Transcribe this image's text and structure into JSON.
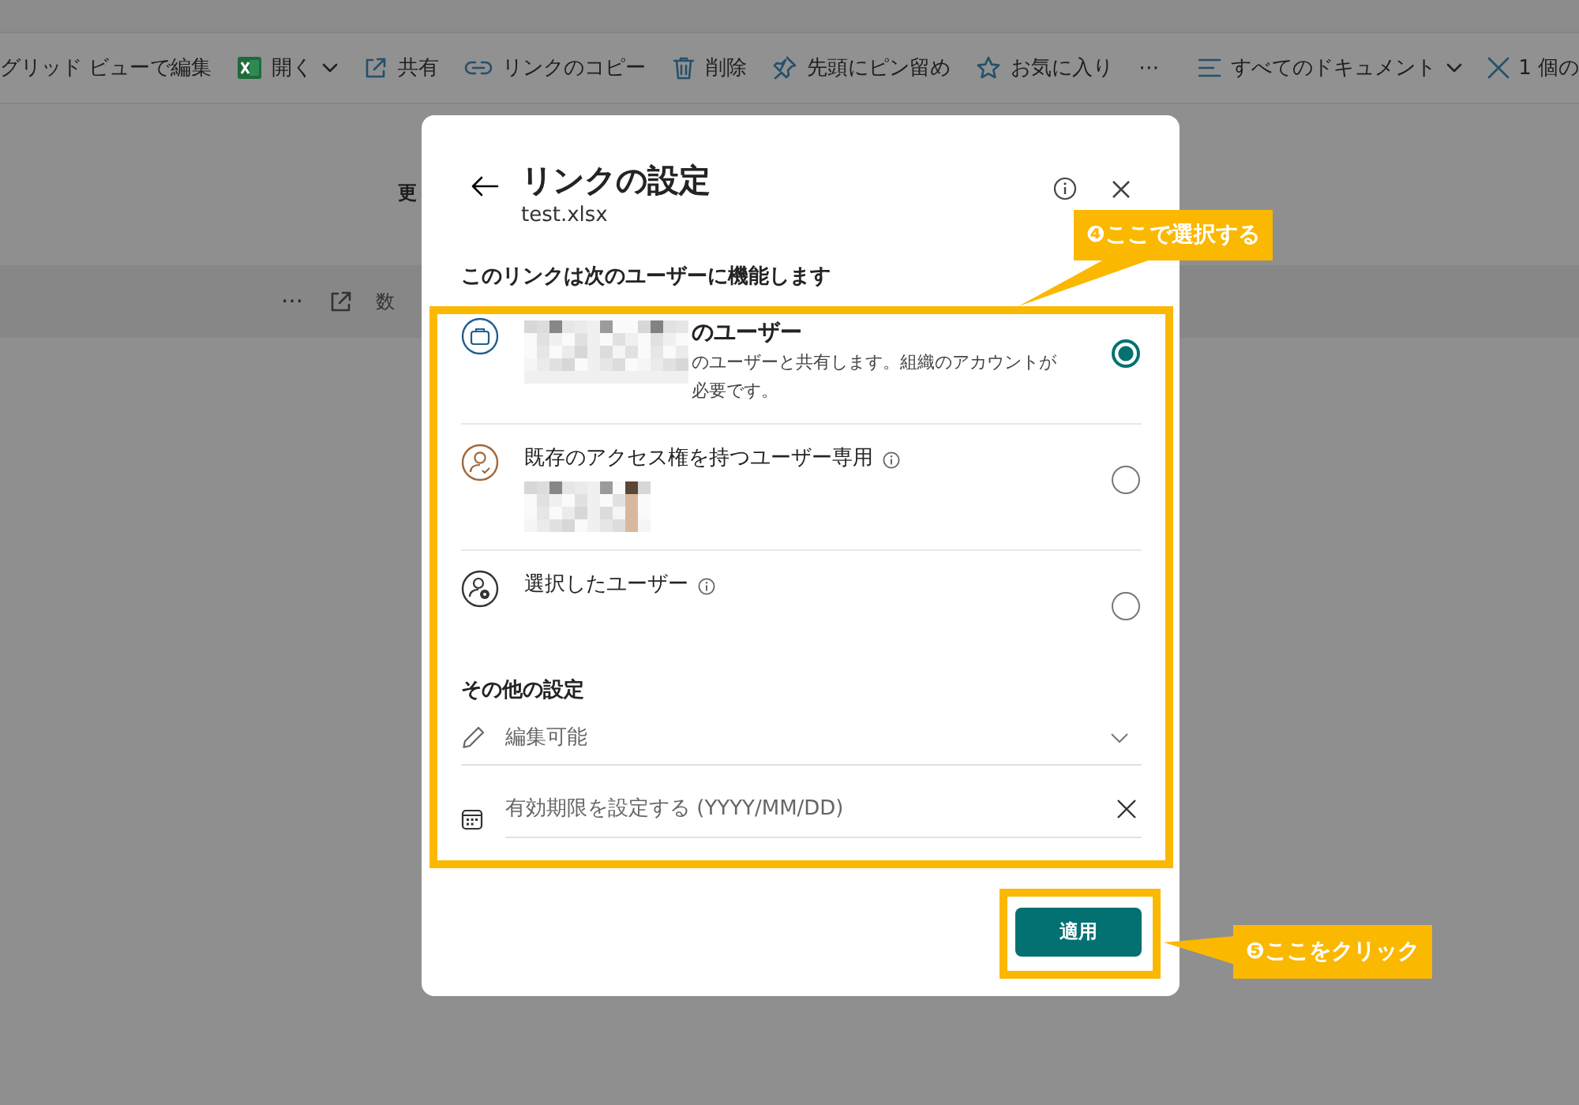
{
  "toolbar": {
    "left": [
      {
        "label": "グリッド ビューで編集",
        "kind": "button"
      },
      {
        "label": "開く",
        "kind": "menu"
      },
      {
        "label": "共有",
        "kind": "button"
      },
      {
        "label": "リンクのコピー",
        "kind": "button"
      },
      {
        "label": "削除",
        "kind": "button"
      },
      {
        "label": "先頭にピン留め",
        "kind": "button"
      },
      {
        "label": "お気に入り",
        "kind": "button"
      },
      {
        "label": "⋯",
        "kind": "button"
      }
    ],
    "right": [
      {
        "label": "すべてのドキュメント",
        "kind": "menu"
      },
      {
        "label": "1 個の",
        "kind": "button"
      }
    ]
  },
  "background": {
    "text": "更",
    "command_bar": {
      "more": "⋯",
      "label": "数"
    }
  },
  "dialog": {
    "title": "リンクの設定",
    "subtitle": "test.xlsx",
    "section_heading": "このリンクは次のユーザーに機能します",
    "options": [
      {
        "kind": "organization",
        "title": "のユーザー",
        "description": "のユーザーと共有します。組織のアカウントが必要です。",
        "info": false,
        "selected": true
      },
      {
        "kind": "existing",
        "title": "既存のアクセス権を持つユーザー専用",
        "info": true,
        "selected": false
      },
      {
        "kind": "specific",
        "title": "選択したユーザー",
        "info": true,
        "selected": false
      }
    ],
    "other_heading": "その他の設定",
    "permission": {
      "value": "編集可能"
    },
    "expiry": {
      "placeholder": "有効期限を設定する (YYYY/MM/DD)"
    },
    "apply_button": "適用"
  },
  "callouts": [
    {
      "text": "❹ここで選択する"
    },
    {
      "text": "❺ここをクリック"
    }
  ]
}
